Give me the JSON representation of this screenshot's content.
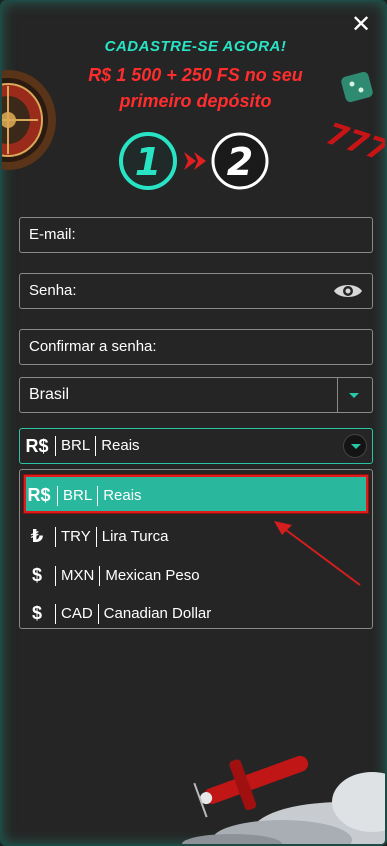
{
  "modal": {
    "close_label": "✕",
    "headline": "CADASTRE-SE AGORA!",
    "promo_line1": "R$ 1 500 + 250 FS no seu",
    "promo_line2": "primeiro depósito",
    "steps": {
      "step1": "1",
      "step2": "2"
    }
  },
  "form": {
    "email_placeholder": "E-mail:",
    "password_placeholder": "Senha:",
    "confirm_placeholder": "Confirmar a senha:",
    "country_value": "Brasil",
    "currency": {
      "symbol": "R$",
      "code": "BRL",
      "name": "Reais"
    }
  },
  "currency_options": [
    {
      "symbol": "R$",
      "code": "BRL",
      "name": "Reais"
    },
    {
      "symbol": "₺",
      "code": "TRY",
      "name": "Lira Turca"
    },
    {
      "symbol": "$",
      "code": "MXN",
      "name": "Mexican Peso"
    },
    {
      "symbol": "$",
      "code": "CAD",
      "name": "Canadian Dollar"
    }
  ],
  "colors": {
    "accent": "#28e4c4",
    "promo": "#ff2d2d",
    "selected_bg": "#29b79d",
    "highlight_border": "#e01b1b",
    "background": "#252525"
  },
  "icons": [
    "close-icon",
    "eye-icon",
    "chevron-down-icon",
    "roulette-icon",
    "dice-icon",
    "sevens-icon",
    "airplane-icon",
    "arrow-annotation-icon"
  ]
}
